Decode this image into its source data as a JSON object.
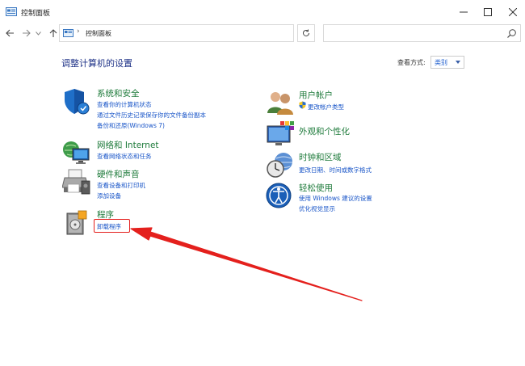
{
  "window": {
    "title": "控制面板",
    "minimize_glyph": "—",
    "maximize_glyph": "☐",
    "close_glyph": "✕"
  },
  "navbar": {
    "back_glyph": "←",
    "forward_glyph": "→",
    "recent_glyph": "⌄",
    "up_glyph": "↑",
    "address_separator": "›",
    "address_text": "控制面板",
    "search_placeholder": ""
  },
  "main": {
    "page_title": "调整计算机的设置",
    "view_by_label": "查看方式:",
    "view_by_value": "类别"
  },
  "categories_left": [
    {
      "title": "系统和安全",
      "links": [
        "查看你的计算机状态",
        "通过文件历史记录保存你的文件备份副本",
        "备份和还原(Windows 7)"
      ]
    },
    {
      "title": "网络和 Internet",
      "links": [
        "查看网络状态和任务"
      ]
    },
    {
      "title": "硬件和声音",
      "links": [
        "查看设备和打印机",
        "添加设备"
      ]
    },
    {
      "title": "程序",
      "links": [
        "卸载程序"
      ]
    }
  ],
  "categories_right": [
    {
      "title": "用户帐户",
      "links": [
        "更改帐户类型"
      ]
    },
    {
      "title": "外观和个性化",
      "links": []
    },
    {
      "title": "时钟和区域",
      "links": [
        "更改日期、时间或数字格式"
      ]
    },
    {
      "title": "轻松使用",
      "links": [
        "使用 Windows 建议的设置",
        "优化视觉显示"
      ]
    }
  ],
  "colors": {
    "title_blue": "#1e3287",
    "category_green": "#1d7a3a",
    "link_blue": "#1a56c8",
    "annotation_red": "#e4201d"
  }
}
